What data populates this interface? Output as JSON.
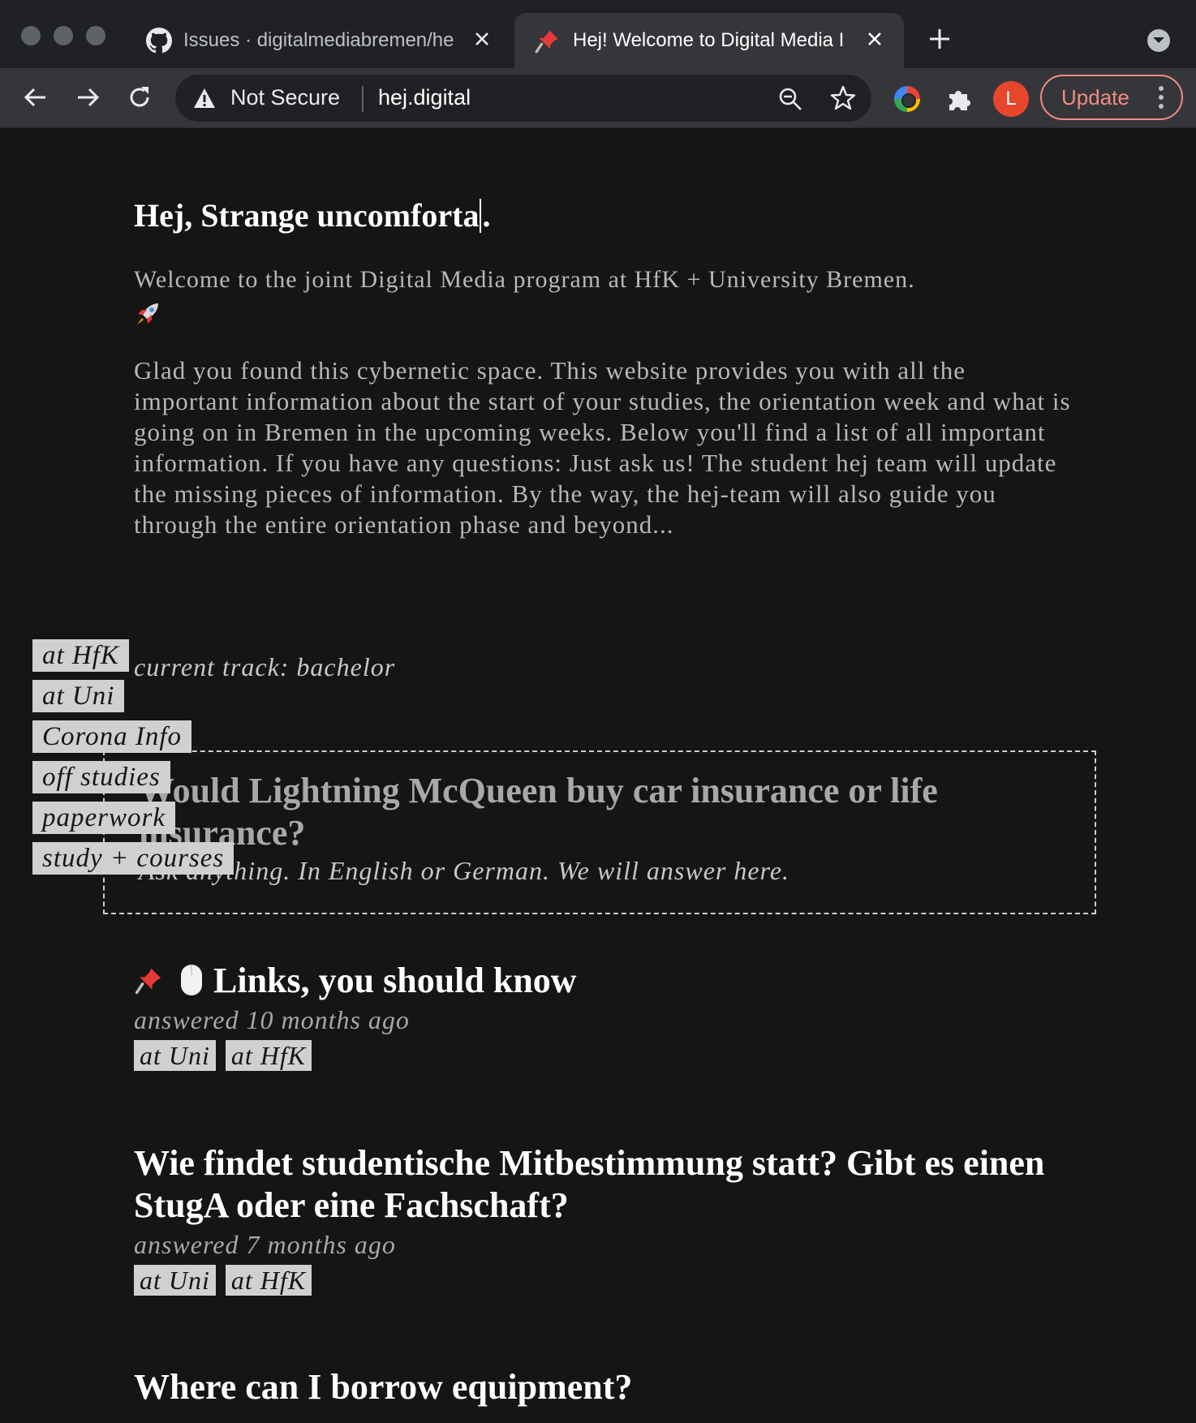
{
  "browser": {
    "tabs": [
      {
        "title": "Issues · digitalmediabremen/he",
        "icon": "github-icon",
        "active": false
      },
      {
        "title": "Hej! Welcome to Digital Media I",
        "icon": "pushpin-icon",
        "active": true
      }
    ],
    "address": {
      "security_label": "Not Secure",
      "url": "hej.digital"
    },
    "profile_initial": "L",
    "update_label": "Update"
  },
  "page": {
    "greeting_before_caret": "Hej, Strange uncomforta",
    "greeting_after_caret": ".",
    "intro": "Welcome to the joint Digital Media program at HfK + University Bremen.",
    "intro_icon": "rocket-icon",
    "body": "Glad you found this cybernetic space. This website provides you with all the important information about the start of your studies, the orientation week and what is going on in Bremen in the upcoming weeks. Below you'll find a list of all important information. If you have any questions: Just ask us! The student hej team will update the missing pieces of information. By the way, the hej-team will also guide you through the entire orientation phase and beyond...",
    "track": "current track: bachelor",
    "category_tags": [
      "at HfK",
      "at Uni",
      "Corona Info",
      "off studies",
      "paperwork",
      "study + courses"
    ],
    "ask": {
      "question": "Would Lightning McQueen buy car insurance or life insurance?",
      "hint": "Ask anything. In English or German. We will answer here."
    },
    "entries": [
      {
        "title": "Links, you should know",
        "meta": "answered 10 months ago",
        "tags": [
          "at Uni",
          "at HfK"
        ],
        "icons": [
          "pushpin-icon",
          "mouse-icon"
        ]
      },
      {
        "title": "Wie findet studentische Mitbestimmung statt? Gibt es einen StugA oder eine Fachschaft?",
        "meta": "answered 7 months ago",
        "tags": [
          "at Uni",
          "at HfK"
        ]
      },
      {
        "title": "Where can I borrow equipment?"
      }
    ]
  },
  "colors": {
    "background": "#151515",
    "tag_bg": "#d0d0d0",
    "update_accent": "#f28b82",
    "avatar": "#e8462c"
  }
}
